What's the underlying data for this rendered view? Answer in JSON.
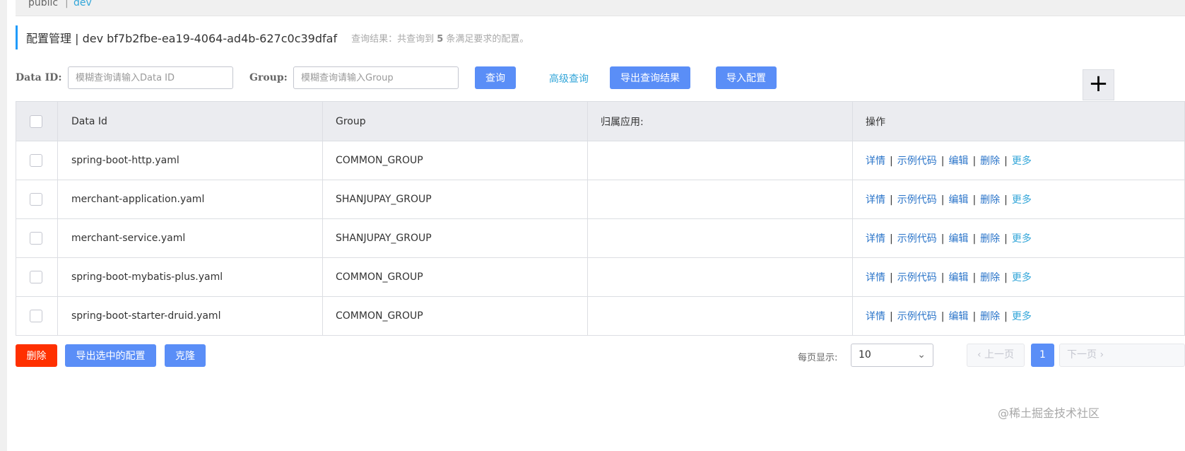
{
  "namespaces": {
    "public": "public",
    "separator": "|",
    "dev": "dev"
  },
  "header": {
    "title": "配置管理  |  dev  bf7b2fbe-ea19-4064-ad4b-627c0c39dfaf",
    "result_prefix": "查询结果：共查询到",
    "result_count": "5",
    "result_suffix": "条满足要求的配置。"
  },
  "search": {
    "dataid_label": "Data ID:",
    "dataid_placeholder": "模糊查询请输入Data ID",
    "group_label": "Group:",
    "group_placeholder": "模糊查询请输入Group",
    "query_button": "查询",
    "advanced_link": "高级查询",
    "export_button": "导出查询结果",
    "import_button": "导入配置",
    "add_icon": "plus-icon",
    "add_glyph": "+"
  },
  "table": {
    "headers": {
      "data_id": "Data Id",
      "group": "Group",
      "app": "归属应用:",
      "ops": "操作"
    },
    "ops": {
      "detail": "详情",
      "sample": "示例代码",
      "edit": "编辑",
      "delete": "删除",
      "more": "更多",
      "sep": "|"
    },
    "rows": [
      {
        "data_id": "spring-boot-http.yaml",
        "group": "COMMON_GROUP",
        "app": ""
      },
      {
        "data_id": "merchant-application.yaml",
        "group": "SHANJUPAY_GROUP",
        "app": ""
      },
      {
        "data_id": "merchant-service.yaml",
        "group": "SHANJUPAY_GROUP",
        "app": ""
      },
      {
        "data_id": "spring-boot-mybatis-plus.yaml",
        "group": "COMMON_GROUP",
        "app": ""
      },
      {
        "data_id": "spring-boot-starter-druid.yaml",
        "group": "COMMON_GROUP",
        "app": ""
      }
    ]
  },
  "footer": {
    "delete_button": "删除",
    "export_selected_button": "导出选中的配置",
    "clone_button": "克隆",
    "page_size_label": "每页显示:",
    "page_size_value": "10",
    "prev_page": "上一页",
    "current_page": "1",
    "next_page": "下一页",
    "prev_icon": "chevron-left-icon",
    "next_icon": "chevron-right-icon"
  },
  "watermark": "@稀土掘金技术社区",
  "colors": {
    "primary": "#5a8ef7",
    "danger": "#ff3000",
    "link": "#2a74c9",
    "accent": "#33a6d9",
    "title_border": "#209bfa"
  }
}
